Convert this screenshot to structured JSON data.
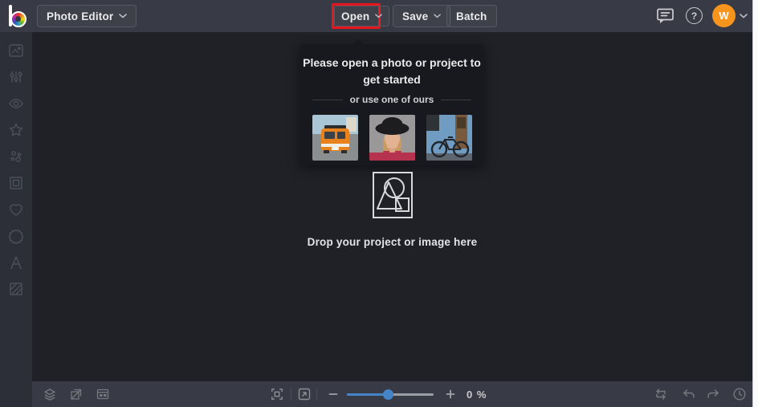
{
  "topbar": {
    "app_menu_label": "Photo Editor",
    "open_label": "Open",
    "save_label": "Save",
    "batch_label": "Batch",
    "help_glyph": "?",
    "avatar_initial": "W"
  },
  "sidebar": {
    "items": [
      {
        "name": "edit-image-icon"
      },
      {
        "name": "adjust-sliders-icon"
      },
      {
        "name": "effects-eye-icon"
      },
      {
        "name": "artsy-star-icon"
      },
      {
        "name": "touchup-dots-icon"
      },
      {
        "name": "frames-icon"
      },
      {
        "name": "graphics-heart-icon"
      },
      {
        "name": "overlays-badge-icon"
      },
      {
        "name": "text-icon"
      },
      {
        "name": "textures-icon"
      }
    ]
  },
  "tooltip": {
    "title_lines": [
      "Please open a photo or project to",
      "get started"
    ],
    "subtitle": "or use one of ours",
    "samples": [
      "orange-van-photo",
      "woman-portrait-photo",
      "blue-bicycle-photo"
    ]
  },
  "dropzone": {
    "label": "Drop your project or image here"
  },
  "bottombar": {
    "zoom_value": "0 %"
  },
  "colors": {
    "topbar_bg": "#383b45",
    "sidebar_bg": "#2c2f37",
    "canvas_bg": "#1f2127",
    "tooltip_bg": "#17191e",
    "annotation_red": "#e8151c",
    "avatar_orange": "#f7941e",
    "slider_blue": "#4584c7"
  }
}
